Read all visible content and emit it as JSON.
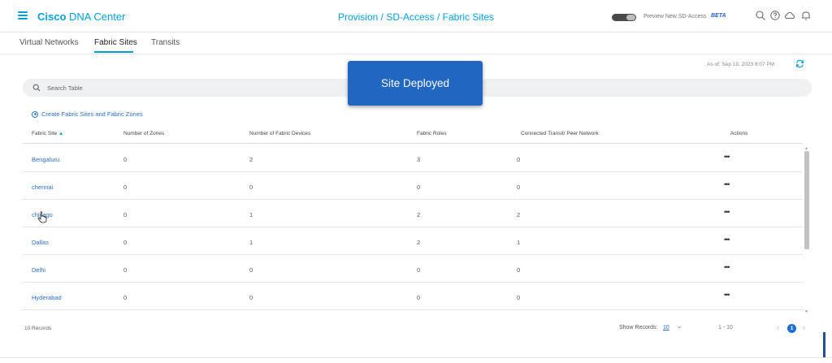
{
  "header": {
    "brand_bold": "Cisco",
    "brand_rest": " DNA Center",
    "breadcrumb": "Provision / SD-Access / Fabric Sites",
    "preview_label": "Preview New SD-Access",
    "beta_label": "BETA",
    "icons": [
      "menu-icon",
      "search-icon",
      "help-icon",
      "cloud-icon",
      "bell-icon"
    ]
  },
  "tabs": [
    {
      "label": "Virtual Networks",
      "active": false
    },
    {
      "label": "Fabric Sites",
      "active": true
    },
    {
      "label": "Transits",
      "active": false
    }
  ],
  "as_of": "As of: Sep 19, 2023 8:07 PM",
  "search": {
    "placeholder": "Search Table"
  },
  "create_link": "Create Fabric Sites and Fabric Zones",
  "table": {
    "columns": [
      "Fabric Site",
      "Number of Zones",
      "Number of Fabric Devices",
      "Fabric Roles",
      "Connected Transit/ Peer Network",
      "Actions"
    ],
    "sort_indicator": "▲",
    "rows": [
      {
        "site": "Bengaluru",
        "zones": "0",
        "devices": "2",
        "roles": "3",
        "transit": "0",
        "actions": "•••"
      },
      {
        "site": "chennai",
        "zones": "0",
        "devices": "0",
        "roles": "0",
        "transit": "0",
        "actions": "•••"
      },
      {
        "site": "chicago",
        "zones": "0",
        "devices": "1",
        "roles": "2",
        "transit": "2",
        "actions": "•••"
      },
      {
        "site": "Dallas",
        "zones": "0",
        "devices": "1",
        "roles": "2",
        "transit": "1",
        "actions": "•••"
      },
      {
        "site": "Delhi",
        "zones": "0",
        "devices": "0",
        "roles": "0",
        "transit": "0",
        "actions": "•••"
      },
      {
        "site": "Hyderabad",
        "zones": "0",
        "devices": "0",
        "roles": "0",
        "transit": "0",
        "actions": "•••"
      }
    ]
  },
  "footer": {
    "records": "10 Records",
    "show_label": "Show Records:",
    "show_value": "10",
    "range": "1 - 10",
    "current_page": "1",
    "prev": "‹",
    "next": "›",
    "chevron": "⌄"
  },
  "toast": {
    "message": "Site Deployed"
  },
  "colors": {
    "accent": "#049fd9",
    "link": "#2a6fc9",
    "toast": "#2166c0"
  }
}
